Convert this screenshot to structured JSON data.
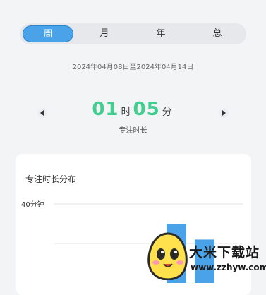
{
  "period_tabs": [
    "周",
    "月",
    "年",
    "总"
  ],
  "period_selected": "周",
  "date_range": "2024年04月08日至2024年04月14日",
  "focus_total": {
    "hours": "01",
    "hours_unit": "时",
    "minutes": "05",
    "minutes_unit": "分",
    "label": "专注时长"
  },
  "distribution_card": {
    "title": "专注时长分布",
    "y_tick_label": "40分钟"
  },
  "chart_data": {
    "type": "bar",
    "y_tick_labels": [
      "40分钟"
    ],
    "ylim": [
      0,
      60
    ],
    "visible_bars_minutes": [
      30,
      22
    ],
    "grid": true
  },
  "colors": {
    "accent": "#4aa3e8",
    "time": "#3fcf8e",
    "bar": "#4aa3e8"
  },
  "watermark": {
    "title": "大米下载站",
    "url": "www.zzhyw.com"
  }
}
